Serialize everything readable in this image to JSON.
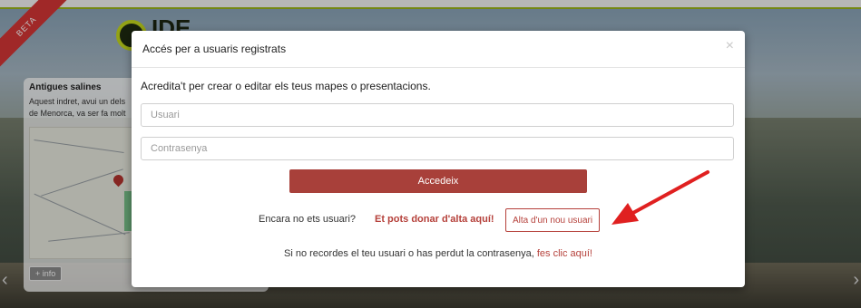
{
  "background": {
    "badge": "BETA",
    "logo_text": "IDE",
    "card": {
      "title": "Antigues salines",
      "description": "Aquest indret, avui un dels de Menorca, va ser fa molt",
      "more_button": "+ info"
    },
    "nav_prev": "‹",
    "nav_next": "›"
  },
  "modal": {
    "title": "Accés per a usuaris registrats",
    "close": "×",
    "lead": "Acredita't per crear o editar els teus mapes o presentacions.",
    "username_placeholder": "Usuari",
    "password_placeholder": "Contrasenya",
    "submit_label": "Accedeix",
    "register_question": "Encara no ets usuari?",
    "register_link": "Et pots donar d'alta aquí!",
    "register_button": "Alta d'un nou usuari",
    "forgot_text": "Si no recordes el teu usuari o has perdut la contrasenya,",
    "forgot_link": "fes clic aquí!"
  },
  "colors": {
    "accent": "#a8403a",
    "link": "#b5403a",
    "annotation_arrow": "#e02020"
  }
}
